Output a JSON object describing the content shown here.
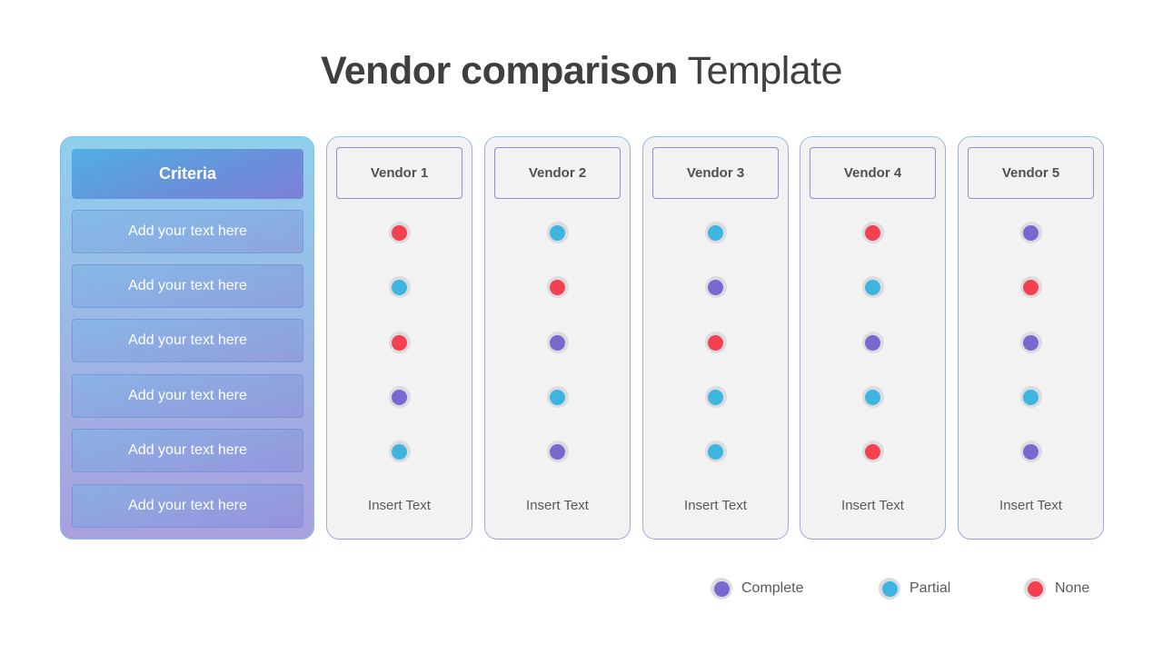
{
  "title": {
    "bold": "Vendor comparison",
    "light": "Template"
  },
  "statuses": {
    "complete": {
      "label": "Complete",
      "color": "#7868d0"
    },
    "partial": {
      "label": "Partial",
      "color": "#3eb5e0"
    },
    "none": {
      "label": "None",
      "color": "#f4414f"
    }
  },
  "criteria": {
    "header": "Criteria",
    "rows": [
      "Add your text here",
      "Add your text here",
      "Add your text here",
      "Add your text here",
      "Add your text here",
      "Add your text here"
    ]
  },
  "vendors": [
    {
      "name": "Vendor 1",
      "statuses": [
        "none",
        "partial",
        "none",
        "complete",
        "partial"
      ],
      "footer": "Insert Text"
    },
    {
      "name": "Vendor 2",
      "statuses": [
        "partial",
        "none",
        "complete",
        "partial",
        "complete"
      ],
      "footer": "Insert Text"
    },
    {
      "name": "Vendor 3",
      "statuses": [
        "partial",
        "complete",
        "none",
        "partial",
        "partial"
      ],
      "footer": "Insert Text"
    },
    {
      "name": "Vendor 4",
      "statuses": [
        "none",
        "partial",
        "complete",
        "partial",
        "none"
      ],
      "footer": "Insert Text"
    },
    {
      "name": "Vendor 5",
      "statuses": [
        "complete",
        "none",
        "complete",
        "partial",
        "complete"
      ],
      "footer": "Insert Text"
    }
  ],
  "legend": [
    {
      "status": "complete",
      "label": "Complete"
    },
    {
      "status": "partial",
      "label": "Partial"
    },
    {
      "status": "none",
      "label": "None"
    }
  ]
}
